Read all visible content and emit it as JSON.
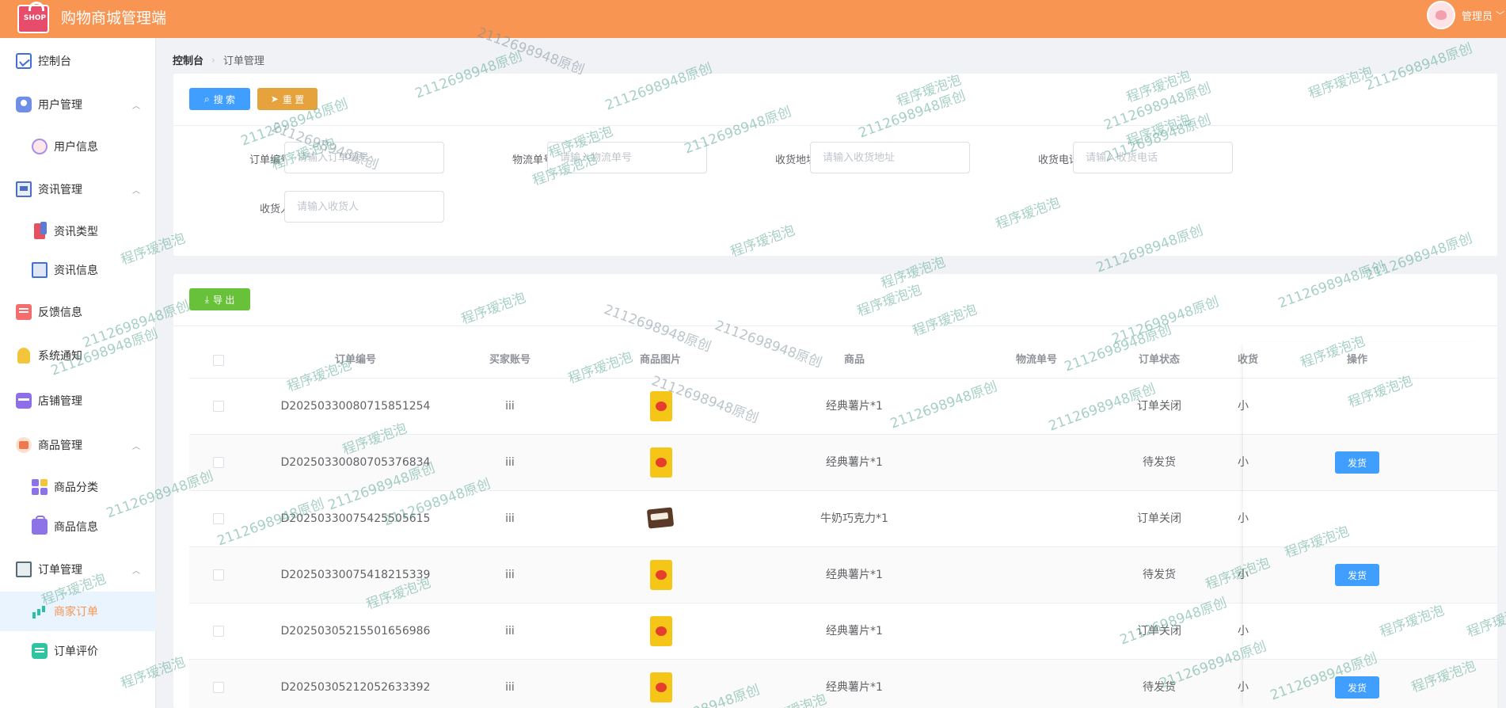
{
  "header": {
    "logo_text": "SHOP",
    "title": "购物商城管理端",
    "user": "管理员"
  },
  "sidebar": {
    "items": [
      {
        "label": "控制台"
      },
      {
        "label": "用户管理"
      },
      {
        "label": "用户信息"
      },
      {
        "label": "资讯管理"
      },
      {
        "label": "资讯类型"
      },
      {
        "label": "资讯信息"
      },
      {
        "label": "反馈信息"
      },
      {
        "label": "系统通知"
      },
      {
        "label": "店铺管理"
      },
      {
        "label": "商品管理"
      },
      {
        "label": "商品分类"
      },
      {
        "label": "商品信息"
      },
      {
        "label": "订单管理"
      },
      {
        "label": "商家订单"
      },
      {
        "label": "订单评价"
      }
    ]
  },
  "breadcrumb": {
    "home": "控制台",
    "current": "订单管理"
  },
  "search": {
    "search_label": "搜 索",
    "reset_label": "重 置",
    "fields": [
      {
        "label": "订单编号",
        "placeholder": "请输入订单编号"
      },
      {
        "label": "物流单号",
        "placeholder": "请输入物流单号"
      },
      {
        "label": "收货地址",
        "placeholder": "请输入收货地址"
      },
      {
        "label": "收货电话",
        "placeholder": "请输入收货电话"
      },
      {
        "label": "收货人",
        "placeholder": "请输入收货人"
      }
    ]
  },
  "table": {
    "export_label": "导 出",
    "columns": [
      "订单编号",
      "买家账号",
      "商品图片",
      "商品",
      "物流单号",
      "订单状态",
      "收货",
      "操作"
    ],
    "ship_label": "发货",
    "rows": [
      {
        "order_no": "D20250330080715851254",
        "buyer": "iii",
        "image": "chips",
        "product": "经典薯片*1",
        "logistics": "",
        "status": "订单关闭",
        "receiver": "小",
        "can_ship": false
      },
      {
        "order_no": "D20250330080705376834",
        "buyer": "iii",
        "image": "chips",
        "product": "经典薯片*1",
        "logistics": "",
        "status": "待发货",
        "receiver": "小",
        "can_ship": true
      },
      {
        "order_no": "D20250330075425505615",
        "buyer": "iii",
        "image": "chocolate",
        "product": "牛奶巧克力*1",
        "logistics": "",
        "status": "订单关闭",
        "receiver": "小",
        "can_ship": false
      },
      {
        "order_no": "D20250330075418215339",
        "buyer": "iii",
        "image": "chips",
        "product": "经典薯片*1",
        "logistics": "",
        "status": "待发货",
        "receiver": "小",
        "can_ship": true
      },
      {
        "order_no": "D20250305215501656986",
        "buyer": "iii",
        "image": "chips",
        "product": "经典薯片*1",
        "logistics": "",
        "status": "订单关闭",
        "receiver": "小",
        "can_ship": false
      },
      {
        "order_no": "D20250305212052633392",
        "buyer": "iii",
        "image": "chips",
        "product": "经典薯片*1",
        "logistics": "",
        "status": "待发货",
        "receiver": "小",
        "can_ship": true
      }
    ]
  },
  "watermarks": {
    "author": "程序瑷泡泡",
    "id": "2112698948原创"
  },
  "colors": {
    "header": "#f89553",
    "primary": "#409eff",
    "warning": "#e6a23c",
    "success": "#67c23a"
  }
}
